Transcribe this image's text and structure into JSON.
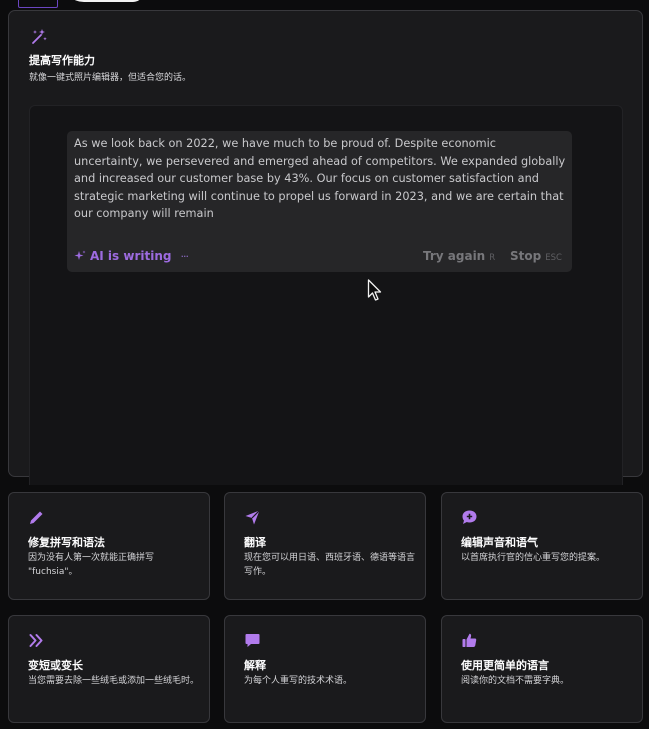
{
  "hero": {
    "title": "提高写作能力",
    "subtitle": "就像一键式照片编辑器，但适合您的话。",
    "icon": "magic-wand-icon"
  },
  "editor": {
    "ai_text": "As we look back on 2022, we have much to be proud of. Despite economic uncertainty, we persevered and emerged ahead of competitors. We expanded globally and increased our customer base by 43%. Our focus on customer satisfaction and strategic marketing will continue to propel us forward in 2023, and we are certain that our company will remain",
    "status_label": "AI is writing",
    "try_again": {
      "label": "Try again",
      "key": "R"
    },
    "stop": {
      "label": "Stop",
      "key": "ESC"
    }
  },
  "cards": [
    {
      "icon": "pencil-icon",
      "title": "修复拼写和语法",
      "desc": "因为没有人第一次就能正确拼写 \"fuchsia\"。"
    },
    {
      "icon": "paper-plane-icon",
      "title": "翻译",
      "desc": "现在您可以用日语、西班牙语、德语等语言写作。"
    },
    {
      "icon": "chat-bubble-plus-icon",
      "title": "编辑声音和语气",
      "desc": "以首席执行官的信心重写您的提案。"
    },
    {
      "icon": "chevrons-right-icon",
      "title": "变短或变长",
      "desc": "当您需要去除一些绒毛或添加一些绒毛时。"
    },
    {
      "icon": "chat-bubble-icon",
      "title": "解释",
      "desc": "为每个人重写的技术术语。"
    },
    {
      "icon": "thumbs-up-icon",
      "title": "使用更简单的语言",
      "desc": "阅读你的文档不需要字典。"
    }
  ],
  "colors": {
    "accent": "#9d6be0",
    "icon": "#b17bec",
    "card_bg": "#1a1a1c",
    "border": "#38383c"
  }
}
